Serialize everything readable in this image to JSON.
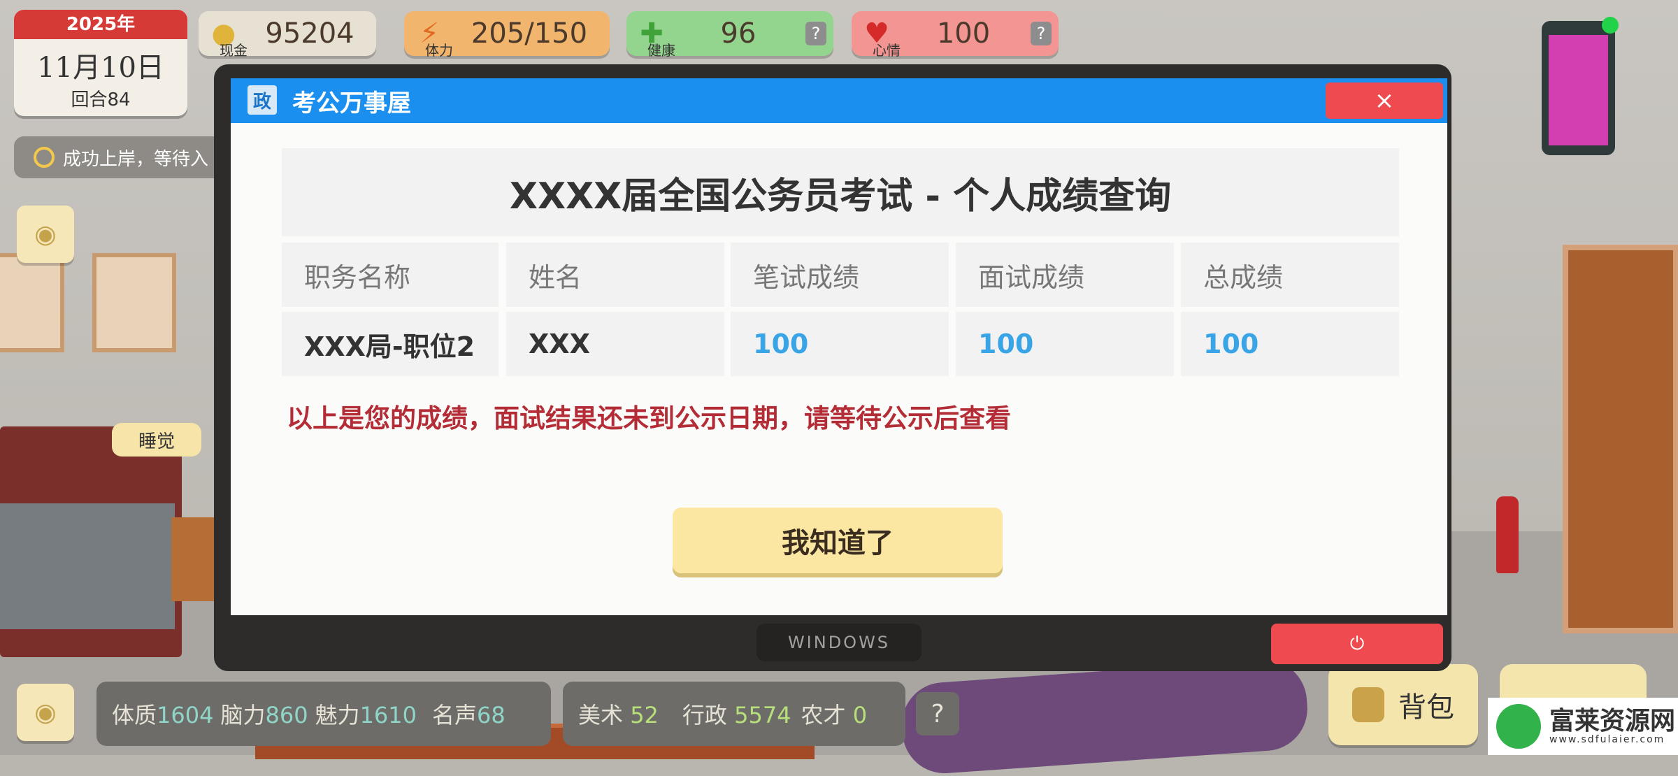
{
  "hud": {
    "year": "2025年",
    "month_day": "11月10日",
    "round": "回合84",
    "cash": {
      "label": "现金",
      "value": "95204"
    },
    "stamina": {
      "label": "体力",
      "value": "205/150"
    },
    "health": {
      "label": "健康",
      "value": "96"
    },
    "mood": {
      "label": "心情",
      "value": "100"
    },
    "help": "?",
    "status_text": "成功上岸，等待入",
    "sleep_bubble": "睡觉",
    "bag": "背包"
  },
  "attributes": [
    {
      "label": "体质",
      "value": "1604"
    },
    {
      "label": "脑力",
      "value": "860"
    },
    {
      "label": "魅力",
      "value": "1610"
    },
    {
      "label": "名声",
      "value": "68"
    },
    {
      "label": "美术",
      "value": "52"
    },
    {
      "label": "行政",
      "value": "5574"
    },
    {
      "label": "农才",
      "value": "0"
    }
  ],
  "window": {
    "logo": "政",
    "title": "考公万事屋",
    "close": "×",
    "heading": "XXXX届全国公务员考试 - 个人成绩查询",
    "columns": [
      "职务名称",
      "姓名",
      "笔试成绩",
      "面试成绩",
      "总成绩"
    ],
    "row": [
      "XXX局-职位2",
      "XXX",
      "100",
      "100",
      "100"
    ],
    "notice": "以上是您的成绩，面试结果还未到公示日期，请等待公示后查看",
    "ok_button": "我知道了",
    "taskbar_label": "WINDOWS",
    "power_icon": "⏻"
  },
  "watermark": {
    "name": "富莱资源网",
    "url": "www.sdfulaier.com"
  },
  "colors": {
    "titlebar": "#1a8ff0",
    "close": "#ef4a4f",
    "score": "#3aa5e6",
    "notice": "#b42d36"
  }
}
